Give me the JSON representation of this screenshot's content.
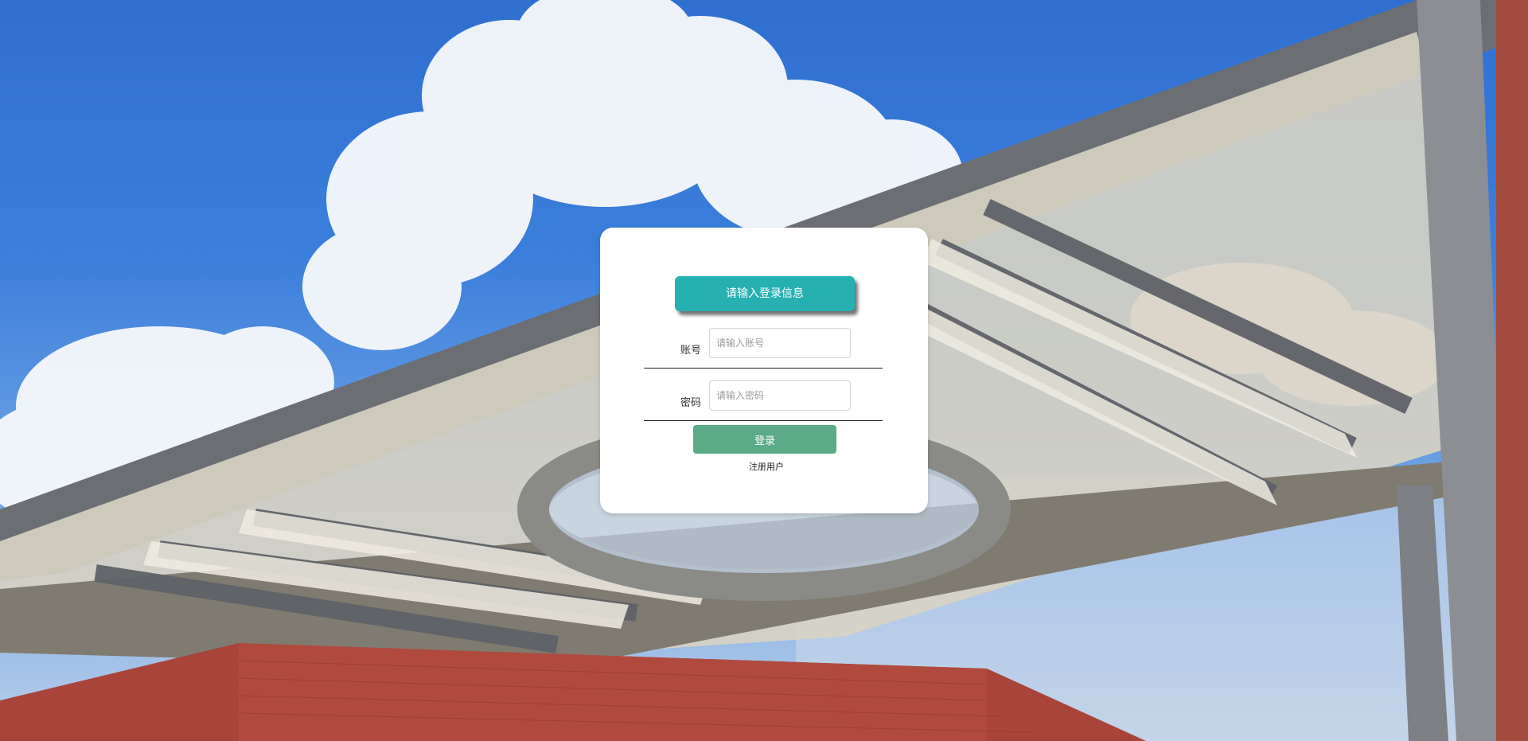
{
  "login": {
    "title": "请输入登录信息",
    "account_label": "账号",
    "account_placeholder": "请输入账号",
    "account_value": "",
    "password_label": "密码",
    "password_placeholder": "请输入密码",
    "password_value": "",
    "submit_label": "登录",
    "register_label": "注册用户"
  },
  "colors": {
    "title_bg": "#26b0b0",
    "button_bg": "#5aab86",
    "card_bg": "#ffffff",
    "sky": "#3b7fdc"
  }
}
